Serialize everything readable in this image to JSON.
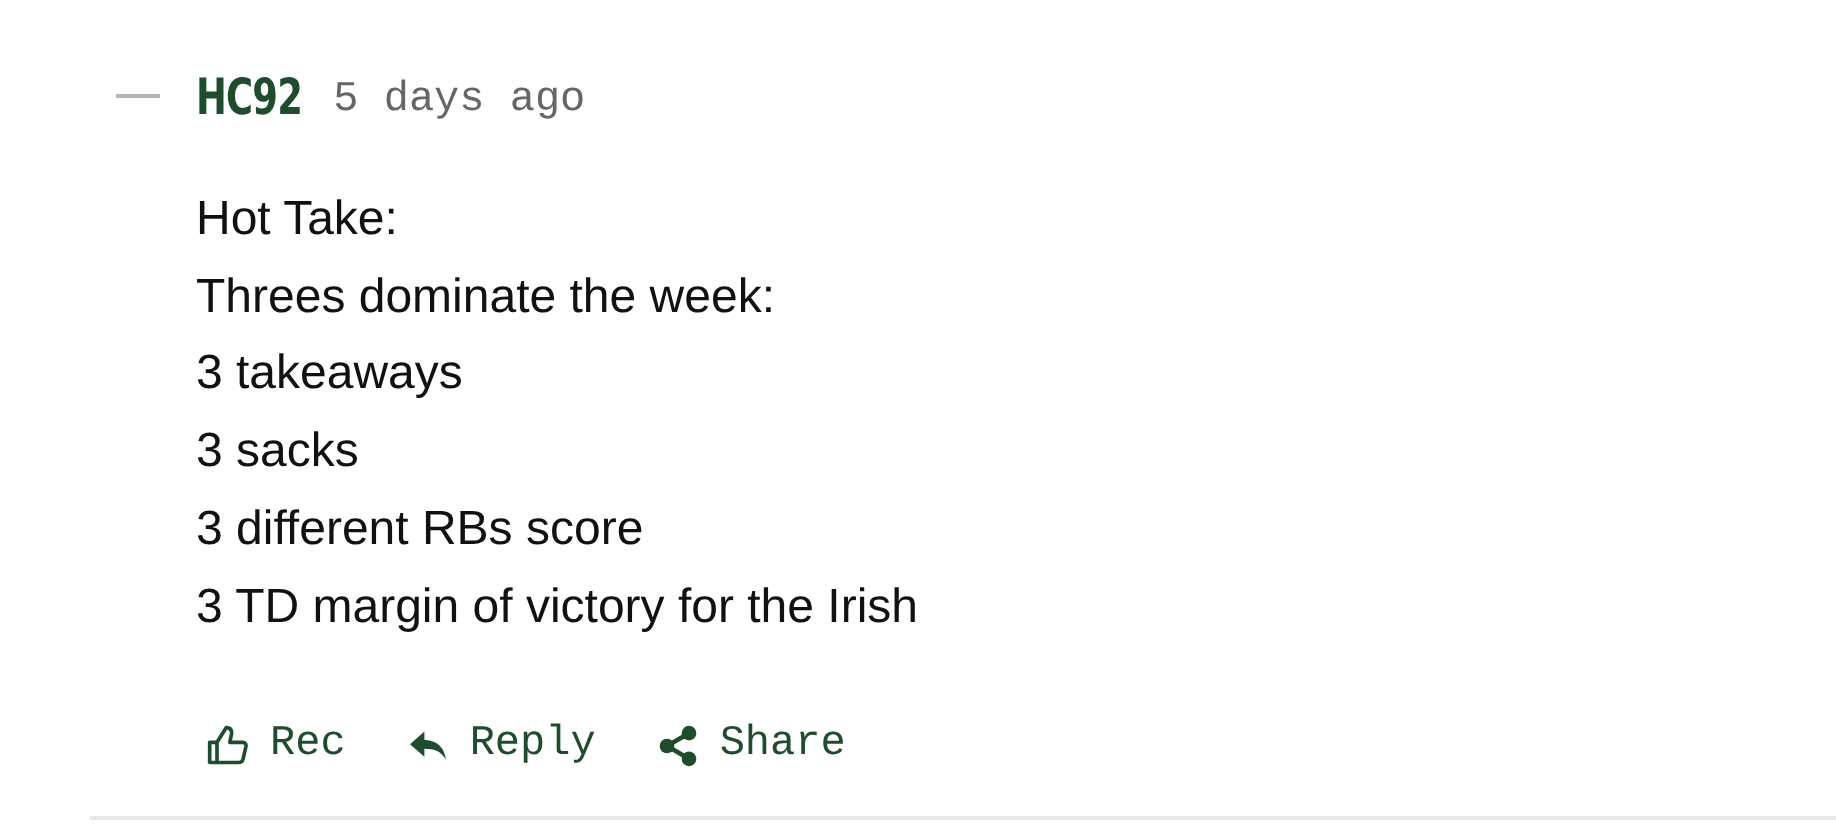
{
  "comment": {
    "author": "HC92",
    "time": "5 days ago",
    "lines": [
      "Hot Take:",
      "Threes dominate the week:",
      "3 takeaways",
      "3 sacks",
      "3 different RBs score",
      "3 TD margin of victory for the Irish"
    ],
    "actions": [
      {
        "kind": "rec",
        "label": "Rec"
      },
      {
        "kind": "reply",
        "label": "Reply"
      },
      {
        "kind": "share",
        "label": "Share"
      }
    ]
  }
}
